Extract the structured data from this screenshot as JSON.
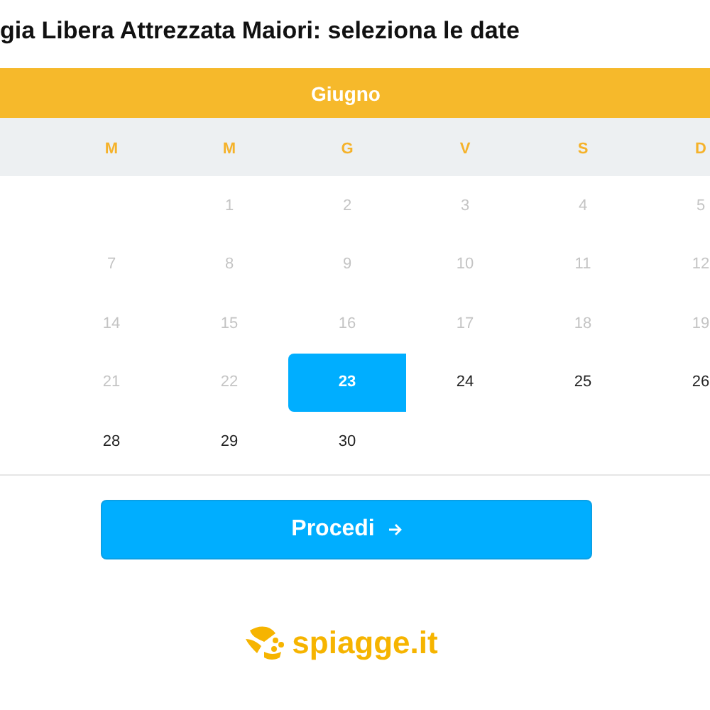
{
  "title": "gia Libera Attrezzata Maiori: seleziona le date",
  "calendar": {
    "month": "Giugno",
    "weekdays": [
      "M",
      "M",
      "G",
      "V",
      "S",
      "D"
    ],
    "weeks": [
      [
        {
          "kind": "blank"
        },
        {
          "kind": "day",
          "label": "1",
          "available": false,
          "selected": false
        },
        {
          "kind": "day",
          "label": "2",
          "available": false,
          "selected": false
        },
        {
          "kind": "day",
          "label": "3",
          "available": false,
          "selected": false
        },
        {
          "kind": "day",
          "label": "4",
          "available": false,
          "selected": false
        },
        {
          "kind": "day",
          "label": "5",
          "available": false,
          "selected": false
        }
      ],
      [
        {
          "kind": "day",
          "label": "7",
          "available": false,
          "selected": false
        },
        {
          "kind": "day",
          "label": "8",
          "available": false,
          "selected": false
        },
        {
          "kind": "day",
          "label": "9",
          "available": false,
          "selected": false
        },
        {
          "kind": "day",
          "label": "10",
          "available": false,
          "selected": false
        },
        {
          "kind": "day",
          "label": "11",
          "available": false,
          "selected": false
        },
        {
          "kind": "day",
          "label": "12",
          "available": false,
          "selected": false
        }
      ],
      [
        {
          "kind": "day",
          "label": "14",
          "available": false,
          "selected": false
        },
        {
          "kind": "day",
          "label": "15",
          "available": false,
          "selected": false
        },
        {
          "kind": "day",
          "label": "16",
          "available": false,
          "selected": false
        },
        {
          "kind": "day",
          "label": "17",
          "available": false,
          "selected": false
        },
        {
          "kind": "day",
          "label": "18",
          "available": false,
          "selected": false
        },
        {
          "kind": "day",
          "label": "19",
          "available": false,
          "selected": false
        }
      ],
      [
        {
          "kind": "day",
          "label": "21",
          "available": false,
          "selected": false
        },
        {
          "kind": "day",
          "label": "22",
          "available": false,
          "selected": false
        },
        {
          "kind": "day",
          "label": "23",
          "available": true,
          "selected": true
        },
        {
          "kind": "day",
          "label": "24",
          "available": true,
          "selected": false
        },
        {
          "kind": "day",
          "label": "25",
          "available": true,
          "selected": false
        },
        {
          "kind": "day",
          "label": "26",
          "available": true,
          "selected": false
        }
      ],
      [
        {
          "kind": "day",
          "label": "28",
          "available": true,
          "selected": false
        },
        {
          "kind": "day",
          "label": "29",
          "available": true,
          "selected": false
        },
        {
          "kind": "day",
          "label": "30",
          "available": true,
          "selected": false
        },
        {
          "kind": "blank"
        },
        {
          "kind": "blank"
        },
        {
          "kind": "blank"
        }
      ]
    ]
  },
  "proceed_button": "Procedi",
  "logo": "spiagge.it"
}
